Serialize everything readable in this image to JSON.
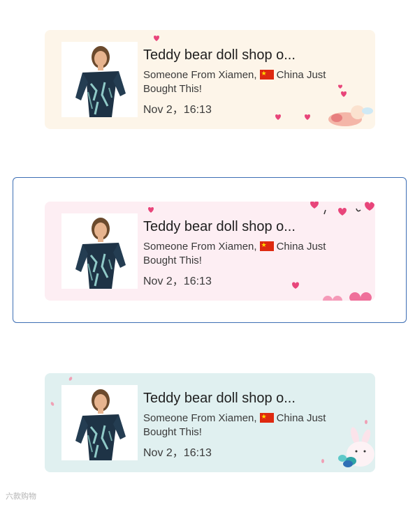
{
  "notifications": [
    {
      "theme": "cream",
      "title": "Teddy bear doll shop o...",
      "message_prefix": "Someone From Xiamen,",
      "message_suffix": "China Just Bought This!",
      "time": "Nov 2，16:13"
    },
    {
      "theme": "pink",
      "title": "Teddy bear doll shop o...",
      "message_prefix": "Someone From Xiamen,",
      "message_suffix": "China Just Bought This!",
      "time": "Nov 2，16:13"
    },
    {
      "theme": "mint",
      "title": "Teddy bear doll shop o...",
      "message_prefix": "Someone From Xiamen,",
      "message_suffix": "China Just Bought This!",
      "time": "Nov 2，16:13"
    }
  ],
  "watermark": "六款购物",
  "colors": {
    "cream_bg": "#fdf5e9",
    "pink_bg": "#fdeef3",
    "mint_bg": "#e0f0f0",
    "selection_border": "#3d6eb4",
    "heart": "#e8457a"
  }
}
